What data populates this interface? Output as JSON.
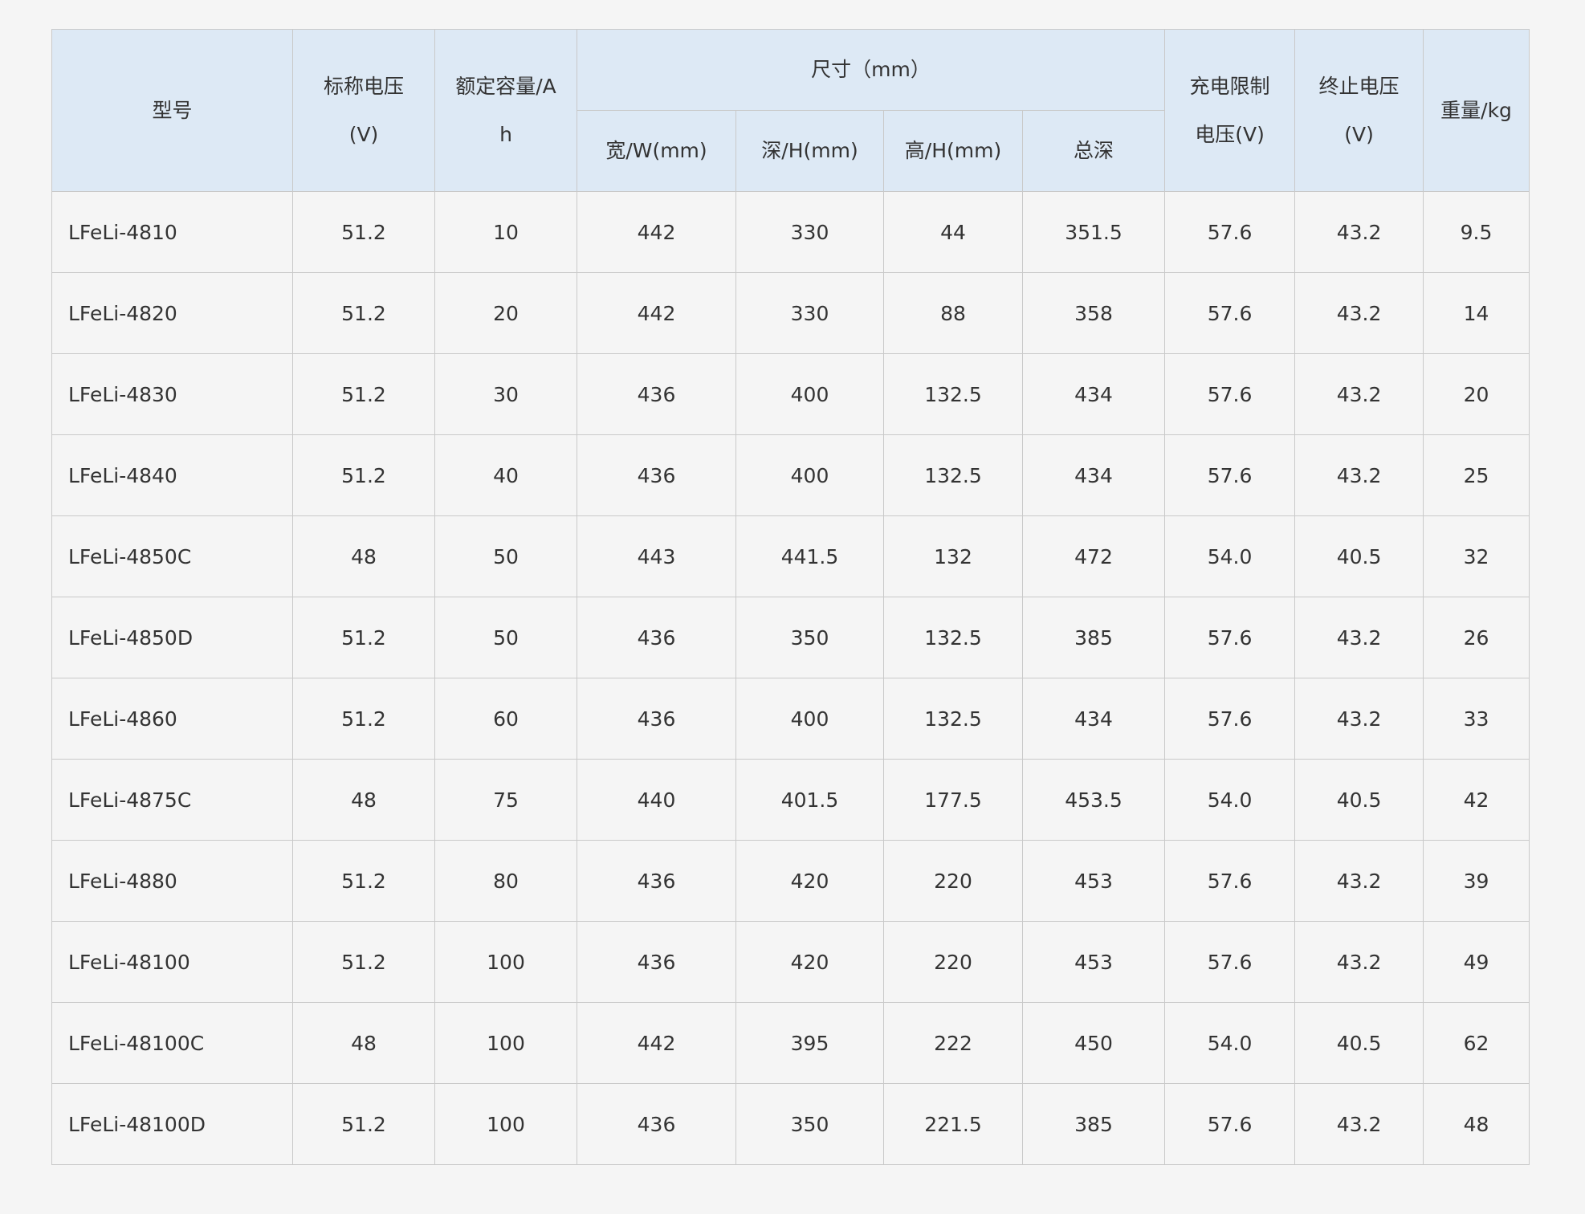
{
  "table": {
    "headers": {
      "model": "型号",
      "nominal_voltage_line1": "标称电压",
      "nominal_voltage_line2": "(V)",
      "capacity_line1": "额定容量/A",
      "capacity_line2": "h",
      "dimensions_group": "尺寸（mm）",
      "width": "宽/W(mm)",
      "depth": "深/H(mm)",
      "height": "高/H(mm)",
      "total_depth": "总深",
      "charge_limit_line1": "充电限制",
      "charge_limit_line2": "电压(V)",
      "cutoff_line1": "终止电压",
      "cutoff_line2": "(V)",
      "weight": "重量/kg"
    },
    "rows": [
      [
        "LFeLi-4810",
        "51.2",
        "10",
        "442",
        "330",
        "44",
        "351.5",
        "57.6",
        "43.2",
        "9.5"
      ],
      [
        "LFeLi-4820",
        "51.2",
        "20",
        "442",
        "330",
        "88",
        "358",
        "57.6",
        "43.2",
        "14"
      ],
      [
        "LFeLi-4830",
        "51.2",
        "30",
        "436",
        "400",
        "132.5",
        "434",
        "57.6",
        "43.2",
        "20"
      ],
      [
        "LFeLi-4840",
        "51.2",
        "40",
        "436",
        "400",
        "132.5",
        "434",
        "57.6",
        "43.2",
        "25"
      ],
      [
        "LFeLi-4850C",
        "48",
        "50",
        "443",
        "441.5",
        "132",
        "472",
        "54.0",
        "40.5",
        "32"
      ],
      [
        "LFeLi-4850D",
        "51.2",
        "50",
        "436",
        "350",
        "132.5",
        "385",
        "57.6",
        "43.2",
        "26"
      ],
      [
        "LFeLi-4860",
        "51.2",
        "60",
        "436",
        "400",
        "132.5",
        "434",
        "57.6",
        "43.2",
        "33"
      ],
      [
        "LFeLi-4875C",
        "48",
        "75",
        "440",
        "401.5",
        "177.5",
        "453.5",
        "54.0",
        "40.5",
        "42"
      ],
      [
        "LFeLi-4880",
        "51.2",
        "80",
        "436",
        "420",
        "220",
        "453",
        "57.6",
        "43.2",
        "39"
      ],
      [
        "LFeLi-48100",
        "51.2",
        "100",
        "436",
        "420",
        "220",
        "453",
        "57.6",
        "43.2",
        "49"
      ],
      [
        "LFeLi-48100C",
        "48",
        "100",
        "442",
        "395",
        "222",
        "450",
        "54.0",
        "40.5",
        "62"
      ],
      [
        "LFeLi-48100D",
        "51.2",
        "100",
        "436",
        "350",
        "221.5",
        "385",
        "57.6",
        "43.2",
        "48"
      ]
    ]
  },
  "colors": {
    "page_background": "#f5f5f5",
    "header_background": "#dde9f5",
    "border": "#c9c9c9",
    "text": "#333333"
  }
}
